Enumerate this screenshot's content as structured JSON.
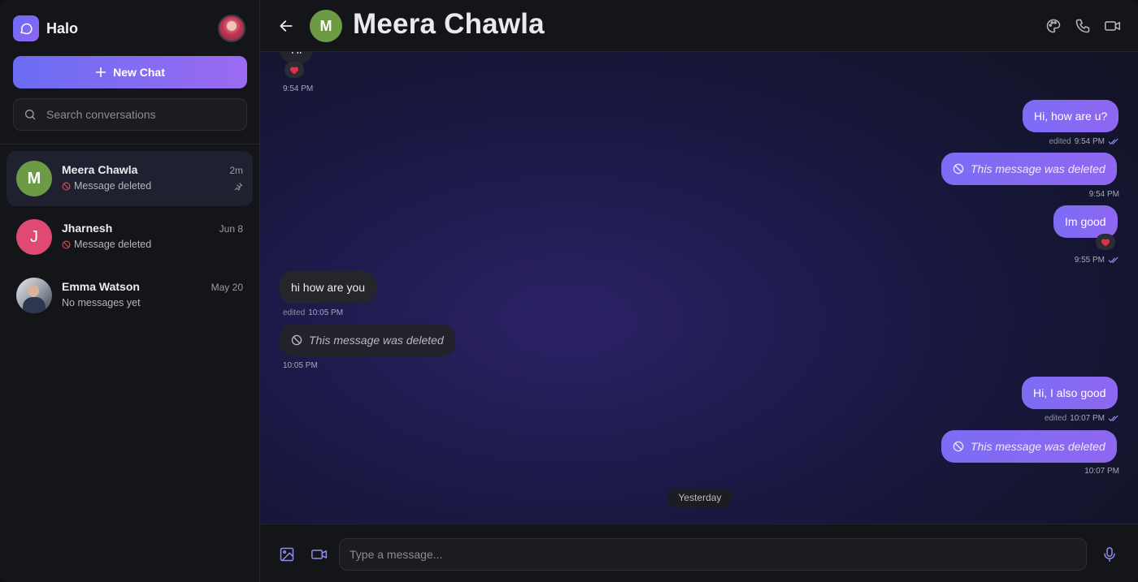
{
  "app": {
    "name": "Halo"
  },
  "sidebar": {
    "new_chat_label": "New Chat",
    "search_placeholder": "Search conversations",
    "conversations": [
      {
        "name": "Meera Chawla",
        "time": "2m",
        "preview": "Message deleted",
        "avatar_letter": "M",
        "avatar_color": "#6d9a44",
        "pinned": true,
        "active": true
      },
      {
        "name": "Jharnesh",
        "time": "Jun 8",
        "preview": "Message deleted",
        "avatar_letter": "J",
        "avatar_color": "#e04a72",
        "pinned": false,
        "active": false
      },
      {
        "name": "Emma Watson",
        "time": "May 20",
        "preview": "No messages yet",
        "avatar_letter": "",
        "avatar_color": "#cfcfcf",
        "pinned": false,
        "active": false
      }
    ]
  },
  "chat": {
    "contact_name": "Meera Chawla",
    "avatar_letter": "M",
    "messages": [
      {
        "dir": "in",
        "text": "Hi",
        "reaction": "heart",
        "time": "9:54 PM",
        "edited": false
      },
      {
        "dir": "out",
        "text": "Hi, how are u?",
        "edited_label": "edited",
        "time": "9:54 PM",
        "read": true
      },
      {
        "dir": "out",
        "text": "This message was deleted",
        "deleted": true,
        "time": "9:54 PM"
      },
      {
        "dir": "out",
        "text": "Im good",
        "reaction": "heart",
        "time": "9:55 PM",
        "read": true
      },
      {
        "dir": "in",
        "text": "hi how are you",
        "edited_label": "edited",
        "time": "10:05 PM"
      },
      {
        "dir": "in",
        "text": "This message was deleted",
        "deleted": true,
        "time": "10:05 PM"
      },
      {
        "dir": "out",
        "text": "Hi, I also good",
        "edited_label": "edited",
        "time": "10:07 PM",
        "read": true
      },
      {
        "dir": "out",
        "text": "This message was deleted",
        "deleted": true,
        "time": "10:07 PM"
      }
    ],
    "date_divider": "Yesterday"
  },
  "composer": {
    "placeholder": "Type a message..."
  },
  "colors": {
    "accent": "#7c6cf4",
    "accent_end": "#9b6bf2",
    "read_check": "#8f8cf0",
    "heart": "#e0314b"
  }
}
